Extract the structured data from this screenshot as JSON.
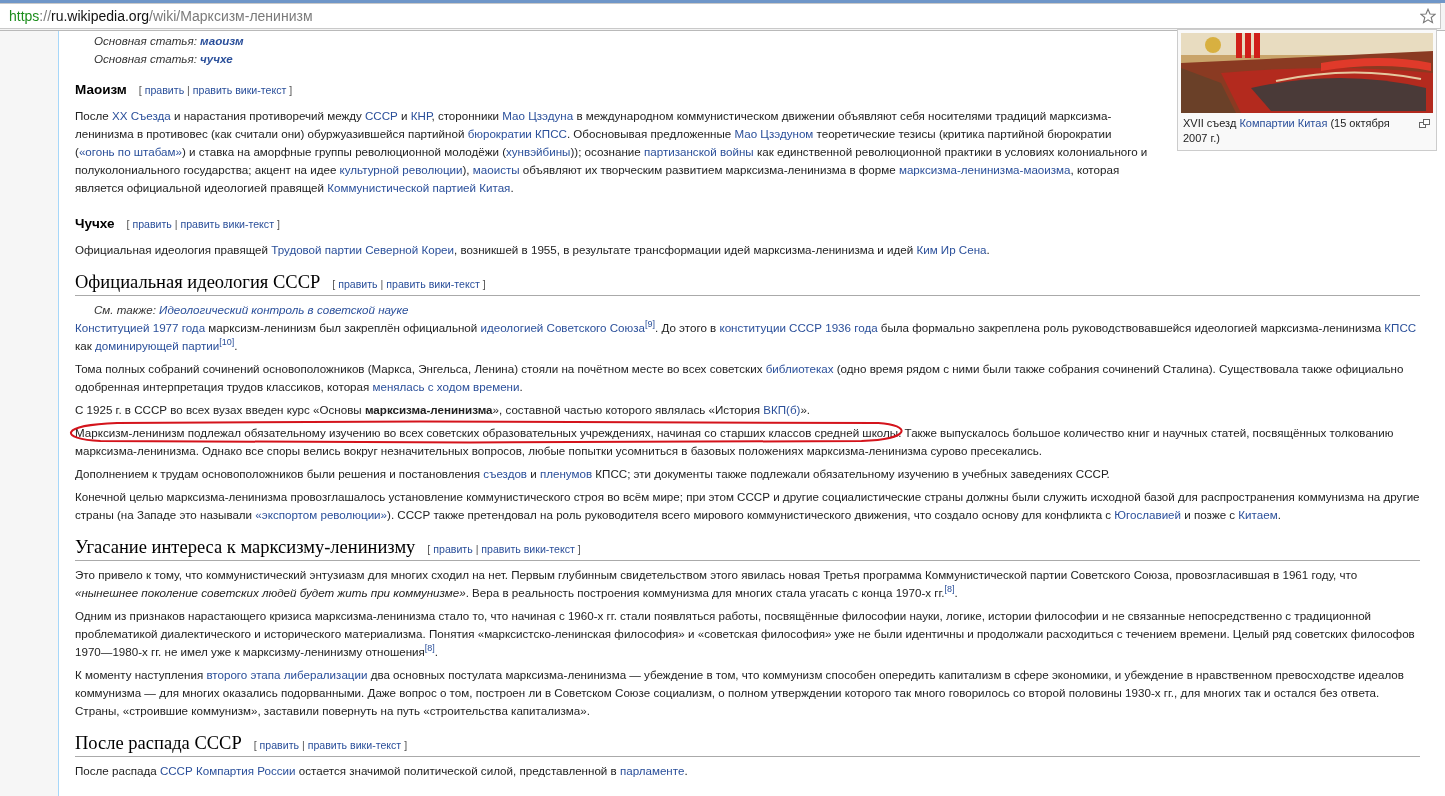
{
  "address_bar": {
    "url": [
      {
        "kind": "scheme",
        "text": "https"
      },
      {
        "kind": "plain",
        "text": "://"
      },
      {
        "kind": "host",
        "text": "ru.wikipedia.org"
      },
      {
        "kind": "plain",
        "text": "/wiki/Марксизм-ленинизм"
      }
    ]
  },
  "figure": {
    "kind": "picture",
    "caption": [
      {
        "kind": "text",
        "text": "XVII съезд "
      },
      {
        "kind": "link",
        "text": "Компартии Китая"
      },
      {
        "kind": "text",
        "text": " (15 октября 2007 г.)"
      }
    ]
  },
  "blocks": [
    {
      "kind": "hatnote",
      "segments": [
        {
          "kind": "text",
          "text": "Основная статья: "
        },
        {
          "kind": "bold-link",
          "text": "маоизм"
        }
      ]
    },
    {
      "kind": "hatnote",
      "segments": [
        {
          "kind": "text",
          "text": "Основная статья: "
        },
        {
          "kind": "bold-link",
          "text": "чучхе"
        }
      ]
    },
    {
      "kind": "h3",
      "title": "Маоизм",
      "edit": [
        {
          "kind": "text",
          "text": "[ "
        },
        {
          "kind": "link",
          "text": "править"
        },
        {
          "kind": "text",
          "text": " | "
        },
        {
          "kind": "link",
          "text": "править вики-текст"
        },
        {
          "kind": "text",
          "text": " ]"
        }
      ]
    },
    {
      "kind": "p",
      "segments": [
        {
          "kind": "text",
          "text": "После "
        },
        {
          "kind": "link",
          "text": "XX Съезда"
        },
        {
          "kind": "text",
          "text": " и нарастания противоречий между "
        },
        {
          "kind": "link",
          "text": "СССР"
        },
        {
          "kind": "text",
          "text": " и "
        },
        {
          "kind": "link",
          "text": "КНР"
        },
        {
          "kind": "text",
          "text": ", сторонники "
        },
        {
          "kind": "link",
          "text": "Мао Цзэдуна"
        },
        {
          "kind": "text",
          "text": " в международном коммунистическом движении объявляют себя носителями традиций марксизма-ленинизма в противовес (как считали они) обуржуазившейся партийной "
        },
        {
          "kind": "link",
          "text": "бюрократии КПСС"
        },
        {
          "kind": "text",
          "text": ". Обосновывая предложенные "
        },
        {
          "kind": "link",
          "text": "Мао Цзэдуном"
        },
        {
          "kind": "text",
          "text": " теоретические тезисы (критика партийной бюрократии ("
        },
        {
          "kind": "link",
          "text": "«огонь по штабам»"
        },
        {
          "kind": "text",
          "text": ") и ставка на аморфные группы революционной молодёжи ("
        },
        {
          "kind": "link",
          "text": "хунвэйбины"
        },
        {
          "kind": "text",
          "text": ")); осознание "
        },
        {
          "kind": "link",
          "text": "партизанской войны"
        },
        {
          "kind": "text",
          "text": " как единственной революционной практики в условиях колониального и полуколониального государства; акцент на идее "
        },
        {
          "kind": "link",
          "text": "культурной революции"
        },
        {
          "kind": "text",
          "text": "), "
        },
        {
          "kind": "link",
          "text": "маоисты"
        },
        {
          "kind": "text",
          "text": " объявляют их творческим развитием марксизма-ленинизма в форме "
        },
        {
          "kind": "link",
          "text": "марксизма-ленинизма-маоизма"
        },
        {
          "kind": "text",
          "text": ", которая является официальной идеологией правящей "
        },
        {
          "kind": "link",
          "text": "Коммунистической партией Китая"
        },
        {
          "kind": "text",
          "text": "."
        }
      ]
    },
    {
      "kind": "h3",
      "title": "Чучхе",
      "edit": [
        {
          "kind": "text",
          "text": "[ "
        },
        {
          "kind": "link",
          "text": "править"
        },
        {
          "kind": "text",
          "text": " | "
        },
        {
          "kind": "link",
          "text": "править вики-текст"
        },
        {
          "kind": "text",
          "text": " ]"
        }
      ]
    },
    {
      "kind": "p",
      "segments": [
        {
          "kind": "text",
          "text": "Официальная идеология правящей "
        },
        {
          "kind": "link",
          "text": "Трудовой партии Северной Кореи"
        },
        {
          "kind": "text",
          "text": ", возникшей в 1955, в результате трансформации идей марксизма-ленинизма и идей "
        },
        {
          "kind": "link",
          "text": "Ким Ир Сена"
        },
        {
          "kind": "text",
          "text": "."
        }
      ]
    },
    {
      "kind": "h2",
      "title": "Официальная идеология СССР",
      "edit": [
        {
          "kind": "text",
          "text": "[ "
        },
        {
          "kind": "link",
          "text": "править"
        },
        {
          "kind": "text",
          "text": " | "
        },
        {
          "kind": "link",
          "text": "править вики-текст"
        },
        {
          "kind": "text",
          "text": " ]"
        }
      ]
    },
    {
      "kind": "hatnote",
      "segments": [
        {
          "kind": "text",
          "text": "См. также: "
        },
        {
          "kind": "link",
          "text": "Идеологический контроль в советской науке"
        }
      ]
    },
    {
      "kind": "p",
      "segments": [
        {
          "kind": "link",
          "text": "Конституцией 1977 года"
        },
        {
          "kind": "text",
          "text": " марксизм-ленинизм был закреплён официальной "
        },
        {
          "kind": "link",
          "text": "идеологией Советского Союза"
        },
        {
          "kind": "ref",
          "text": "[9]"
        },
        {
          "kind": "text",
          "text": ". До этого в "
        },
        {
          "kind": "link",
          "text": "конституции СССР 1936 года"
        },
        {
          "kind": "text",
          "text": " была формально закреплена роль руководствовавшейся идеологией марксизма-ленинизма "
        },
        {
          "kind": "link",
          "text": "КПСС"
        },
        {
          "kind": "text",
          "text": " как "
        },
        {
          "kind": "link",
          "text": "доминирующей партии"
        },
        {
          "kind": "ref",
          "text": "[10]"
        },
        {
          "kind": "text",
          "text": "."
        }
      ]
    },
    {
      "kind": "p",
      "segments": [
        {
          "kind": "text",
          "text": "Тома полных собраний сочинений основоположников (Маркса, Энгельса, Ленина) стояли на почётном месте во всех советских "
        },
        {
          "kind": "link",
          "text": "библиотеках"
        },
        {
          "kind": "text",
          "text": " (одно время рядом с ними были также собрания сочинений Сталина). Существовала также официально одобренная интерпретация трудов классиков, которая "
        },
        {
          "kind": "link",
          "text": "менялась с ходом времени"
        },
        {
          "kind": "text",
          "text": "."
        }
      ]
    },
    {
      "kind": "p",
      "segments": [
        {
          "kind": "text",
          "text": "С 1925 г. в СССР во всех вузах введен курс «Основы "
        },
        {
          "kind": "bold",
          "text": "марксизма-ленинизма"
        },
        {
          "kind": "text",
          "text": "», составной частью которого являлась «История "
        },
        {
          "kind": "link",
          "text": "ВКП(б)"
        },
        {
          "kind": "text",
          "text": "»."
        }
      ]
    },
    {
      "kind": "p",
      "segments": [
        {
          "kind": "circled",
          "text": "Марксизм-ленинизм подлежал обязательному изучению во всех советских образовательных учреждениях, начиная со старших классов средней школы."
        },
        {
          "kind": "text",
          "text": " Также выпускалось большое количество книг и научных статей, посвящённых толкованию марксизма-ленинизма. Однако все споры велись вокруг незначительных вопросов, любые попытки усомниться в базовых положениях марксизма-ленинизма сурово пресекались."
        }
      ]
    },
    {
      "kind": "p",
      "segments": [
        {
          "kind": "text",
          "text": "Дополнением к трудам основоположников были решения и постановления "
        },
        {
          "kind": "link",
          "text": "съездов"
        },
        {
          "kind": "text",
          "text": " и "
        },
        {
          "kind": "link",
          "text": "пленумов"
        },
        {
          "kind": "text",
          "text": " КПСС; эти документы также подлежали обязательному изучению в учебных заведениях СССР."
        }
      ]
    },
    {
      "kind": "p",
      "segments": [
        {
          "kind": "text",
          "text": "Конечной целью марксизма-ленинизма провозглашалось установление коммунистического строя во всём мире; при этом СССР и другие социалистические страны должны были служить исходной базой для распространения коммунизма на другие страны (на Западе это называли "
        },
        {
          "kind": "link",
          "text": "«экспортом революции»"
        },
        {
          "kind": "text",
          "text": "). СССР также претендовал на роль руководителя всего мирового коммунистического движения, что создало основу для конфликта с "
        },
        {
          "kind": "link",
          "text": "Югославией"
        },
        {
          "kind": "text",
          "text": " и позже с "
        },
        {
          "kind": "link",
          "text": "Китаем"
        },
        {
          "kind": "text",
          "text": "."
        }
      ]
    },
    {
      "kind": "h2",
      "title": "Угасание интереса к марксизму-ленинизму",
      "edit": [
        {
          "kind": "text",
          "text": "[ "
        },
        {
          "kind": "link",
          "text": "править"
        },
        {
          "kind": "text",
          "text": " | "
        },
        {
          "kind": "link",
          "text": "править вики-текст"
        },
        {
          "kind": "text",
          "text": " ]"
        }
      ]
    },
    {
      "kind": "p",
      "segments": [
        {
          "kind": "text",
          "text": "Это привело к тому, что коммунистический энтузиазм для многих сходил на нет. Первым глубинным свидетельством этого явилась новая Третья программа Коммунистической партии Советского Союза, провозгласившая в 1961 году, что "
        },
        {
          "kind": "italic",
          "text": "«нынешнее поколение советских людей будет жить при коммунизме»"
        },
        {
          "kind": "text",
          "text": ". Вера в реальность построения коммунизма для многих стала угасать с конца 1970-х гг."
        },
        {
          "kind": "ref",
          "text": "[8]"
        },
        {
          "kind": "text",
          "text": "."
        }
      ]
    },
    {
      "kind": "p",
      "segments": [
        {
          "kind": "text",
          "text": "Одним из признаков нарастающего кризиса марксизма-ленинизма стало то, что начиная с 1960-х гг. стали появляться работы, посвящённые философии науки, логике, истории философии и не связанные непосредственно с традиционной проблематикой диалектического и исторического материализма. Понятия «марксистско-ленинская философия» и «советская философия» уже не были идентичны и продолжали расходиться с течением времени. Целый ряд советских философов 1970—1980-х гг. не имел уже к марксизму-ленинизму отношения"
        },
        {
          "kind": "ref",
          "text": "[8]"
        },
        {
          "kind": "text",
          "text": "."
        }
      ]
    },
    {
      "kind": "p",
      "segments": [
        {
          "kind": "text",
          "text": "К моменту наступления "
        },
        {
          "kind": "link",
          "text": "второго этапа либерализации"
        },
        {
          "kind": "text",
          "text": " два основных постулата марксизма-ленинизма — убеждение в том, что коммунизм способен опередить капитализм в сфере экономики, и убеждение в нравственном превосходстве идеалов коммунизма — для многих оказались подорванными. Даже вопрос о том, построен ли в Советском Союзе социализм, о полном утверждении которого так много говорилось со второй половины 1930-х гг., для многих так и остался без ответа. Страны, «строившие коммунизм», заставили повернуть на путь «строительства капитализма»."
        }
      ]
    },
    {
      "kind": "h2",
      "title": "После распада СССР",
      "edit": [
        {
          "kind": "text",
          "text": "[ "
        },
        {
          "kind": "link",
          "text": "править"
        },
        {
          "kind": "text",
          "text": " | "
        },
        {
          "kind": "link",
          "text": "править вики-текст"
        },
        {
          "kind": "text",
          "text": " ]"
        }
      ]
    },
    {
      "kind": "p",
      "segments": [
        {
          "kind": "text",
          "text": "После распада "
        },
        {
          "kind": "link",
          "text": "СССР"
        },
        {
          "kind": "space"
        },
        {
          "kind": "link",
          "text": "Компартия России"
        },
        {
          "kind": "text",
          "text": " остается значимой политической силой, представленной в "
        },
        {
          "kind": "link",
          "text": "парламенте"
        },
        {
          "kind": "text",
          "text": "."
        }
      ]
    }
  ]
}
